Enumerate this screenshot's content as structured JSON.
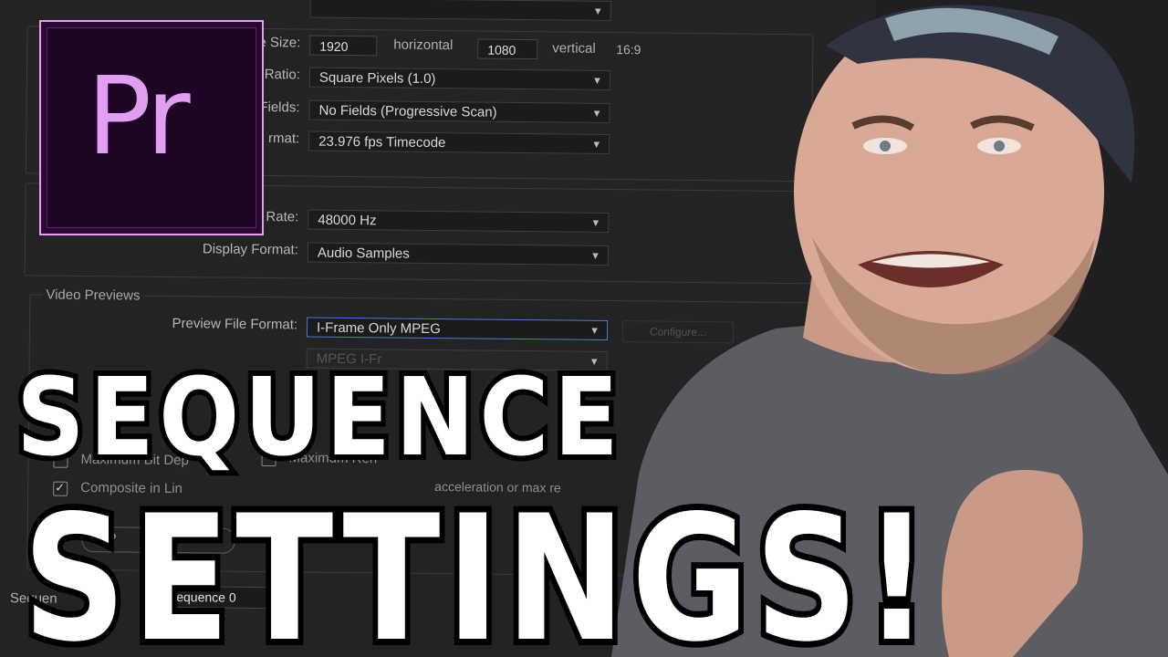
{
  "dialog": {
    "video": {
      "frame_size_label": "e Size:",
      "frame_width": "1920",
      "horizontal_label": "horizontal",
      "frame_height": "1080",
      "vertical_label": "vertical",
      "aspect_ratio": "16:9",
      "pixel_aspect_label": "Ratio:",
      "pixel_aspect_value": "Square Pixels (1.0)",
      "fields_label": "Fields:",
      "fields_value": "No Fields (Progressive Scan)",
      "display_format_label": "rmat:",
      "display_format_value": "23.976 fps Timecode"
    },
    "audio": {
      "sample_rate_label": "Rate:",
      "sample_rate_value": "48000 Hz",
      "display_format_label": "Display Format:",
      "display_format_value": "Audio Samples"
    },
    "video_previews": {
      "section_title": "Video Previews",
      "preview_file_format_label": "Preview File Format:",
      "preview_file_format_value": "I-Frame Only MPEG",
      "configure_label": "Configure...",
      "codec_value": "MPEG I-Fr",
      "max_bit_depth_label": "Maximum Bit Dep",
      "max_render_label": "Maximum Ren",
      "composite_label": "Composite in Lin",
      "composite_note": "acceleration or max re",
      "save_preset_label": "e P"
    },
    "sequence_name_label": "Sequen",
    "sequence_name_value": "Sequence 0"
  },
  "logo": {
    "text": "Pr"
  },
  "headline": {
    "line1": "SEQUENCE",
    "line2": "SETTINGS!"
  },
  "colors": {
    "accent": "#e29ef3",
    "logo_bg": "#2a0a2e",
    "focus": "#4c7bd3"
  }
}
